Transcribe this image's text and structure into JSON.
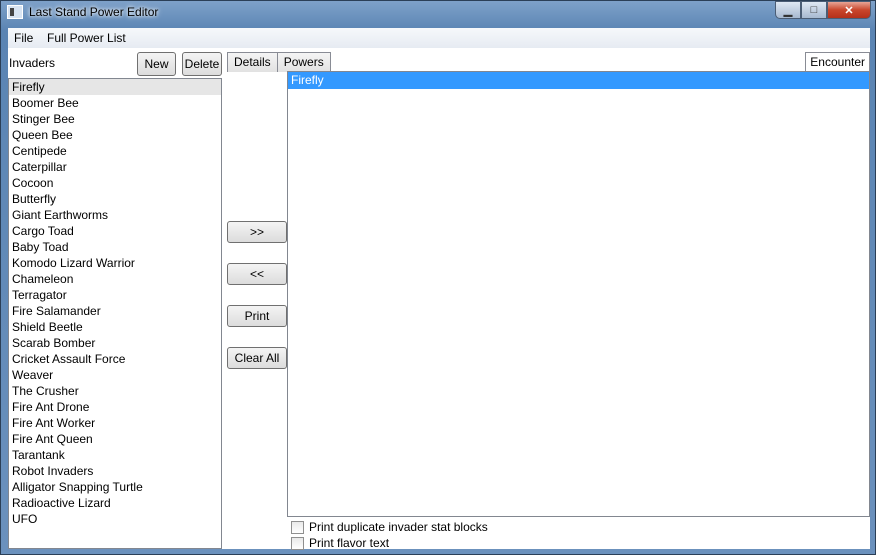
{
  "window": {
    "title": "Last Stand Power Editor",
    "controls": {
      "minimize": "▁",
      "maximize": "□",
      "close": "✕"
    }
  },
  "menu": {
    "items": [
      "File",
      "Full Power List"
    ]
  },
  "invaders": {
    "label": "Invaders",
    "new_button": "New",
    "delete_button": "Delete",
    "items": [
      "Firefly",
      "Boomer Bee",
      "Stinger Bee",
      "Queen Bee",
      "Centipede",
      "Caterpillar",
      "Cocoon",
      "Butterfly",
      "Giant Earthworms",
      "Cargo Toad",
      "Baby Toad",
      "Komodo Lizard Warrior",
      "Chameleon",
      "Terragator",
      "Fire Salamander",
      "Shield Beetle",
      "Scarab Bomber",
      "Cricket Assault Force",
      "Weaver",
      "The Crusher",
      "Fire Ant Drone",
      "Fire Ant Worker",
      "Fire Ant Queen",
      "Tarantank",
      "Robot Invaders",
      "Alligator Snapping Turtle",
      "Radioactive Lizard",
      "UFO"
    ]
  },
  "tabs": [
    "Details",
    "Powers"
  ],
  "actions": {
    "add": ">>",
    "remove": "<<",
    "print": "Print",
    "clear_all": "Clear All"
  },
  "encounter": {
    "label": "Encounter",
    "items": [
      "Firefly"
    ]
  },
  "options": {
    "duplicate_stat_blocks": "Print duplicate invader stat blocks",
    "flavor_text": "Print flavor text"
  },
  "colors": {
    "selection": "#3399ff",
    "title_gradient": "#6b91bd",
    "close_button": "#c9462c"
  }
}
